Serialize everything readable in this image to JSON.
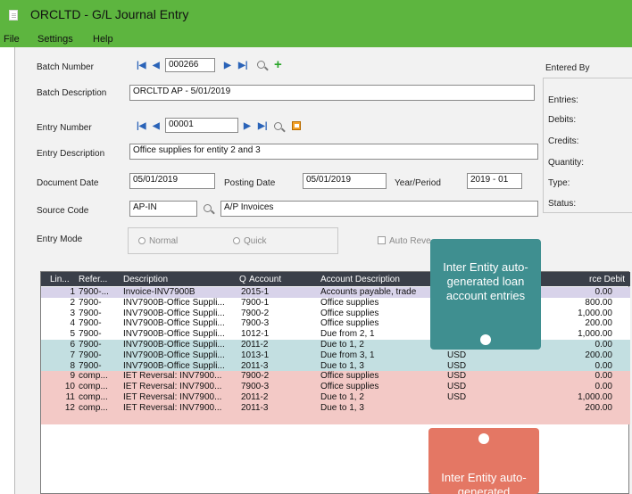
{
  "window": {
    "title": "ORCLTD - G/L Journal Entry"
  },
  "menu": [
    "File",
    "Settings",
    "Help"
  ],
  "form": {
    "batch_number_label": "Batch Number",
    "batch_number": "000266",
    "batch_desc_label": "Batch Description",
    "batch_desc": "ORCLTD AP - 5/01/2019",
    "entry_number_label": "Entry Number",
    "entry_number": "00001",
    "entry_desc_label": "Entry Description",
    "entry_desc": "Office supplies for entity 2 and 3",
    "doc_date_label": "Document Date",
    "doc_date": "05/01/2019",
    "posting_date_label": "Posting Date",
    "posting_date": "05/01/2019",
    "year_period_label": "Year/Period",
    "year_period": "2019 - 01",
    "source_code_label": "Source Code",
    "source_code": "AP-IN",
    "source_desc": "A/P Invoices",
    "entry_mode_label": "Entry Mode",
    "mode_normal": "Normal",
    "mode_quick": "Quick",
    "auto_rev": "Auto Reve"
  },
  "side": {
    "entered_by": "Entered By",
    "entries": "Entries:",
    "debits": "Debits:",
    "credits": "Credits:",
    "quantity": "Quantity:",
    "type": "Type:",
    "status": "Status:"
  },
  "grid": {
    "headers": [
      "Lin...",
      "Refer...",
      "Description",
      "Account",
      "Account Description",
      "rce Debit"
    ],
    "rows": [
      {
        "line": "1",
        "ref": "7900-...",
        "desc": "Invoice-INV7900B",
        "account": "2015-1",
        "acct_desc": "Accounts payable, trade",
        "cur": "",
        "debit": "0.00"
      },
      {
        "line": "2",
        "ref": "7900-",
        "desc": "INV7900B-Office Suppli...",
        "account": "7900-1",
        "acct_desc": "Office supplies",
        "cur": "",
        "debit": "800.00"
      },
      {
        "line": "3",
        "ref": "7900-",
        "desc": "INV7900B-Office Suppli...",
        "account": "7900-2",
        "acct_desc": "Office supplies",
        "cur": "",
        "debit": "1,000.00"
      },
      {
        "line": "4",
        "ref": "7900-",
        "desc": "INV7900B-Office Suppli...",
        "account": "7900-3",
        "acct_desc": "Office supplies",
        "cur": "USD",
        "debit": "200.00"
      },
      {
        "line": "5",
        "ref": "7900-",
        "desc": "INV7900B-Office Suppli...",
        "account": "1012-1",
        "acct_desc": "Due from 2, 1",
        "cur": "USD",
        "debit": "1,000.00"
      },
      {
        "line": "6",
        "ref": "7900-",
        "desc": "INV7900B-Office Suppli...",
        "account": "2011-2",
        "acct_desc": "Due to 1, 2",
        "cur": "USD",
        "debit": "0.00"
      },
      {
        "line": "7",
        "ref": "7900-",
        "desc": "INV7900B-Office Suppli...",
        "account": "1013-1",
        "acct_desc": "Due from 3, 1",
        "cur": "USD",
        "debit": "200.00"
      },
      {
        "line": "8",
        "ref": "7900-",
        "desc": "INV7900B-Office Suppli...",
        "account": "2011-3",
        "acct_desc": "Due to 1, 3",
        "cur": "USD",
        "debit": "0.00"
      },
      {
        "line": "9",
        "ref": "comp...",
        "desc": "IET Reversal: INV7900...",
        "account": "7900-2",
        "acct_desc": "Office supplies",
        "cur": "USD",
        "debit": "0.00"
      },
      {
        "line": "10",
        "ref": "comp...",
        "desc": "IET Reversal: INV7900...",
        "account": "7900-3",
        "acct_desc": "Office supplies",
        "cur": "USD",
        "debit": "0.00"
      },
      {
        "line": "11",
        "ref": "comp...",
        "desc": "IET Reversal: INV7900...",
        "account": "2011-2",
        "acct_desc": "Due to 1, 2",
        "cur": "USD",
        "debit": "1,000.00"
      },
      {
        "line": "12",
        "ref": "comp...",
        "desc": "IET Reversal: INV7900...",
        "account": "2011-3",
        "acct_desc": "Due to 1, 3",
        "cur": "",
        "debit": "200.00"
      }
    ]
  },
  "callouts": {
    "teal": "Inter Entity auto-generated loan account entries",
    "red": "Inter Entity auto-generated reversals"
  },
  "colors": {
    "title_green": "#5db53f",
    "row_purple": "#d8d3ea",
    "row_teal": "#c3dfe1",
    "row_red": "#f3c9c6",
    "callout_teal": "#3f8f90",
    "callout_red": "#e47764"
  }
}
